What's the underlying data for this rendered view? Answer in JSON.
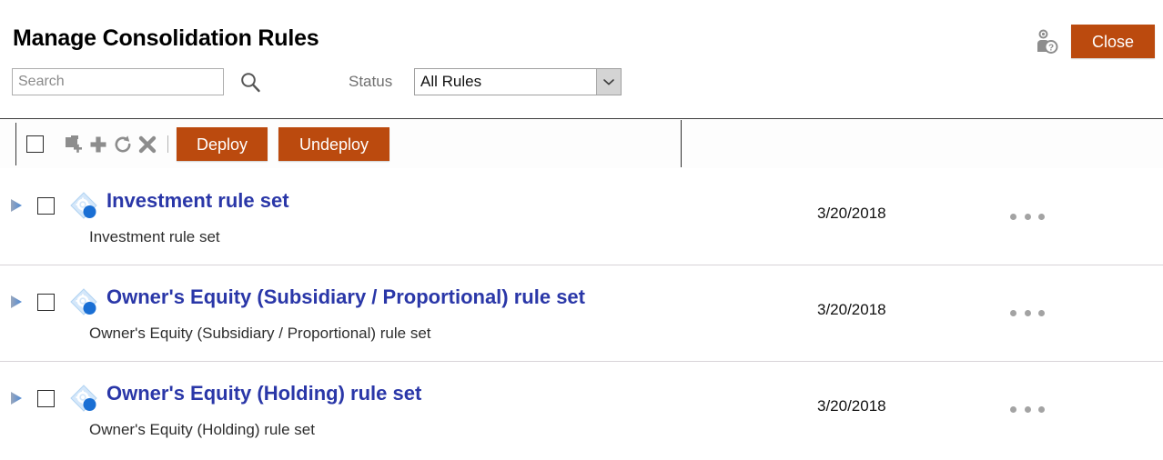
{
  "header": {
    "title": "Manage Consolidation Rules",
    "users_help_icon": "users-help-icon",
    "close_label": "Close"
  },
  "filters": {
    "search_placeholder": "Search",
    "search_value": "",
    "search_icon": "search-icon",
    "status_label": "Status",
    "status_value": "All Rules",
    "status_options": [
      "All Rules"
    ]
  },
  "toolbar": {
    "select_all_checked": false,
    "icons": [
      {
        "name": "copy-add-icon",
        "title": "Copy"
      },
      {
        "name": "plus-icon",
        "title": "New"
      },
      {
        "name": "refresh-icon",
        "title": "Refresh"
      },
      {
        "name": "delete-icon",
        "title": "Delete"
      }
    ],
    "deploy_label": "Deploy",
    "undeploy_label": "Undeploy"
  },
  "rules": [
    {
      "title": "Investment rule set",
      "description": "Investment rule set",
      "date": "3/20/2018",
      "expanded": false,
      "checked": false
    },
    {
      "title": "Owner's Equity (Subsidiary / Proportional) rule set",
      "description": "Owner's Equity (Subsidiary / Proportional) rule set",
      "date": "3/20/2018",
      "expanded": false,
      "checked": false
    },
    {
      "title": "Owner's Equity (Holding) rule set",
      "description": "Owner's Equity (Holding) rule set",
      "date": "3/20/2018",
      "expanded": false,
      "checked": false
    }
  ],
  "colors": {
    "accent_orange": "#bb4a0e",
    "link_blue": "#2a37a8",
    "icon_grey": "#8d8d8d",
    "rule_icon_blue": "#1a6fd4",
    "rule_icon_light": "#c9e0f7"
  }
}
